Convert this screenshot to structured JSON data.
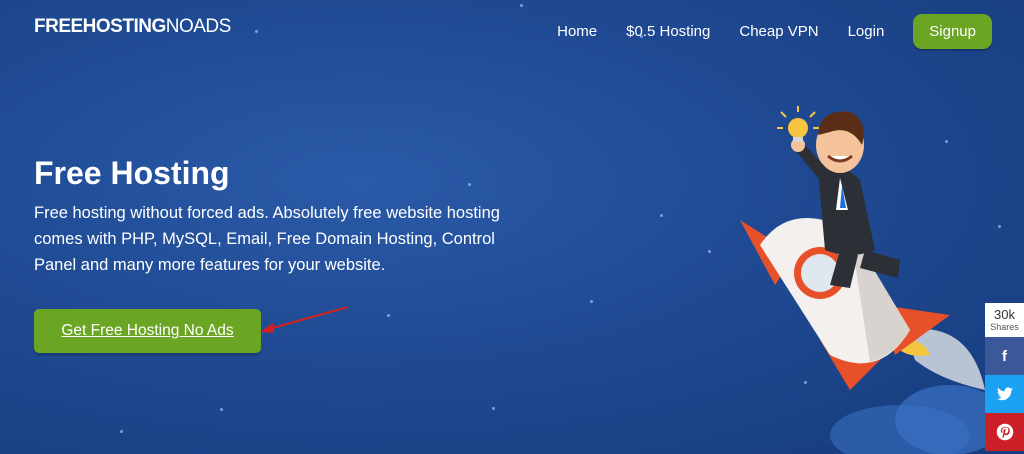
{
  "header": {
    "logo_bold": "FREEHOSTING",
    "logo_light": "NOADS",
    "nav": [
      "Home",
      "$0.5 Hosting",
      "Cheap VPN",
      "Login"
    ],
    "signup_label": "Signup"
  },
  "hero": {
    "title": "Free Hosting",
    "description": "Free hosting without forced ads. Absolutely free website hosting comes with PHP, MySQL, Email, Free Domain Hosting, Control Panel and many more features for your website.",
    "cta_label": "Get Free Hosting No Ads"
  },
  "share": {
    "count": "30k",
    "count_label": "Shares",
    "facebook_glyph": "f",
    "twitter_glyph": "t",
    "pinterest_glyph": "P"
  },
  "colors": {
    "background": "#1f4a93",
    "accent_green": "#6aa523",
    "facebook": "#3b5998",
    "twitter": "#1da1f2",
    "pinterest": "#cb2027"
  }
}
